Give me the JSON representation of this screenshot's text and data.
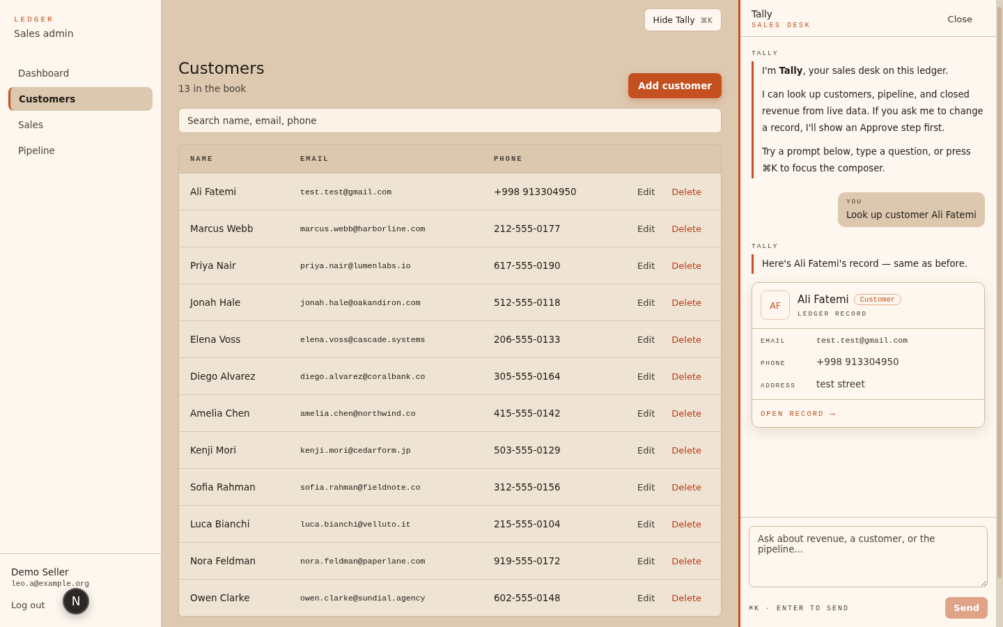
{
  "sidebar": {
    "brand": "LEDGER",
    "subtitle": "Sales admin",
    "items": [
      {
        "label": "Dashboard",
        "selected": false
      },
      {
        "label": "Customers",
        "selected": true
      },
      {
        "label": "Sales",
        "selected": false
      },
      {
        "label": "Pipeline",
        "selected": false
      }
    ],
    "user": {
      "name": "Demo Seller",
      "email": "leo.a@example.org",
      "logout": "Log out"
    },
    "dev_badge": "N"
  },
  "main": {
    "toggle_button": {
      "label": "Hide Tally",
      "shortcut": "⌘K"
    },
    "title": "Customers",
    "subtitle": "13 in the book",
    "add_button": "Add customer",
    "search": {
      "placeholder": "Search name, email, phone"
    },
    "table": {
      "columns": [
        "NAME",
        "EMAIL",
        "PHONE"
      ],
      "rows": [
        {
          "name": "Ali Fatemi",
          "email": "test.test@gmail.com",
          "phone": "+998 913304950",
          "actions": [
            "Edit",
            "Delete"
          ]
        },
        {
          "name": "Marcus Webb",
          "email": "marcus.webb@harborline.com",
          "phone": "212-555-0177",
          "actions": [
            "Edit",
            "Delete"
          ]
        },
        {
          "name": "Priya Nair",
          "email": "priya.nair@lumenlabs.io",
          "phone": "617-555-0190",
          "actions": [
            "Edit",
            "Delete"
          ]
        },
        {
          "name": "Jonah Hale",
          "email": "jonah.hale@oakandiron.com",
          "phone": "512-555-0118",
          "actions": [
            "Edit",
            "Delete"
          ]
        },
        {
          "name": "Elena Voss",
          "email": "elena.voss@cascade.systems",
          "phone": "206-555-0133",
          "actions": [
            "Edit",
            "Delete"
          ]
        },
        {
          "name": "Diego Alvarez",
          "email": "diego.alvarez@coralbank.co",
          "phone": "305-555-0164",
          "actions": [
            "Edit",
            "Delete"
          ]
        },
        {
          "name": "Amelia Chen",
          "email": "amelia.chen@northwind.co",
          "phone": "415-555-0142",
          "actions": [
            "Edit",
            "Delete"
          ]
        },
        {
          "name": "Kenji Mori",
          "email": "kenji.mori@cedarform.jp",
          "phone": "503-555-0129",
          "actions": [
            "Edit",
            "Delete"
          ]
        },
        {
          "name": "Sofia Rahman",
          "email": "sofia.rahman@fieldnote.co",
          "phone": "312-555-0156",
          "actions": [
            "Edit",
            "Delete"
          ]
        },
        {
          "name": "Luca Bianchi",
          "email": "luca.bianchi@velluto.it",
          "phone": "215-555-0104",
          "actions": [
            "Edit",
            "Delete"
          ]
        },
        {
          "name": "Nora Feldman",
          "email": "nora.feldman@paperlane.com",
          "phone": "919-555-0172",
          "actions": [
            "Edit",
            "Delete"
          ]
        },
        {
          "name": "Owen Clarke",
          "email": "owen.clarke@sundial.agency",
          "phone": "602-555-0148",
          "actions": [
            "Edit",
            "Delete"
          ]
        }
      ]
    }
  },
  "assistant": {
    "title": "Tally",
    "subtitle": "SALES DESK",
    "close": "Close",
    "messages": [
      {
        "kind": "assistant",
        "author": "TALLY",
        "paragraphs": [
          "I'm **Tally**, your sales desk on this ledger.",
          "I can look up customers, pipeline, and closed revenue from live data. If you ask me to change a record, I'll show an Approve step first.",
          "Try a prompt below, type a question, or press ⌘K to focus the composer."
        ]
      },
      {
        "kind": "user",
        "author": "YOU",
        "text": "Look up customer Ali Fatemi"
      },
      {
        "kind": "assistant",
        "author": "TALLY",
        "paragraphs": [
          "Here's Ali Fatemi's record — same as before."
        ]
      },
      {
        "kind": "record",
        "initials": "AF",
        "name": "Ali Fatemi",
        "tag": "Customer",
        "caption": "LEDGER RECORD",
        "fields": [
          {
            "label": "EMAIL",
            "value": "test.test@gmail.com",
            "kind": "code"
          },
          {
            "label": "PHONE",
            "value": "+998 913304950",
            "kind": "text"
          },
          {
            "label": "ADDRESS",
            "value": "test street",
            "kind": "text"
          }
        ],
        "link": "OPEN RECORD ⟶"
      }
    ],
    "composer": {
      "placeholder": "Ask about revenue, a customer, or the pipeline...",
      "hint": "⌘K · ENTER TO SEND",
      "send": {
        "label": "Send",
        "disabled": true
      }
    }
  }
}
